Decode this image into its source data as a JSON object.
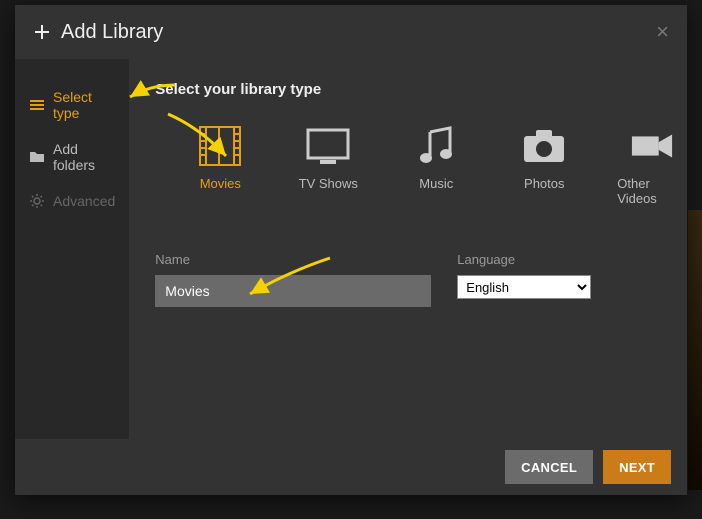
{
  "header": {
    "title": "Add Library"
  },
  "sidebar": {
    "items": [
      {
        "label": "Select type"
      },
      {
        "label": "Add folders"
      },
      {
        "label": "Advanced"
      }
    ]
  },
  "content": {
    "heading": "Select your library type",
    "types": [
      {
        "label": "Movies"
      },
      {
        "label": "TV Shows"
      },
      {
        "label": "Music"
      },
      {
        "label": "Photos"
      },
      {
        "label": "Other Videos"
      }
    ],
    "name_label": "Name",
    "name_value": "Movies",
    "language_label": "Language",
    "language_value": "English"
  },
  "footer": {
    "cancel": "CANCEL",
    "next": "NEXT"
  },
  "colors": {
    "accent": "#e5a00d",
    "next_btn": "#cc7b19"
  }
}
